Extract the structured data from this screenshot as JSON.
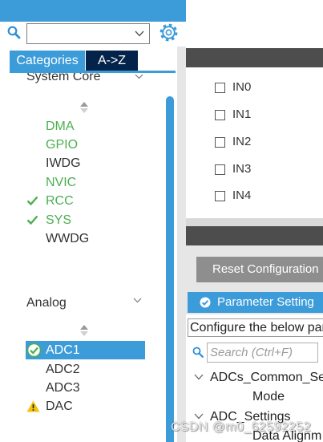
{
  "colors": {
    "accent_blue": "#3c9bd9",
    "navy": "#03234b",
    "enabled_green": "#4caf50",
    "default_text": "#333333",
    "warning_yellow": "#f4c20d",
    "toolbar_dark": "#4d4d4d",
    "button_gray": "#8e8e8e"
  },
  "search": {
    "value": "",
    "icon": "search-icon",
    "dropdown_icon": "chevron-down-icon"
  },
  "settings_icon": "gear-icon",
  "tabs": [
    {
      "label": "Categories",
      "active": true
    },
    {
      "label": "A->Z",
      "active": false
    }
  ],
  "categories": [
    {
      "name": "System Core",
      "expanded": true,
      "sort_icon": "sort-icon",
      "items": [
        {
          "label": "DMA",
          "color": "#4caf50",
          "icon": null
        },
        {
          "label": "GPIO",
          "color": "#4caf50",
          "icon": null
        },
        {
          "label": "IWDG",
          "color": "#333333",
          "icon": null
        },
        {
          "label": "NVIC",
          "color": "#4caf50",
          "icon": null
        },
        {
          "label": "RCC",
          "color": "#4caf50",
          "icon": "check-icon"
        },
        {
          "label": "SYS",
          "color": "#4caf50",
          "icon": "check-icon"
        },
        {
          "label": "WWDG",
          "color": "#333333",
          "icon": null
        }
      ]
    },
    {
      "name": "Analog",
      "expanded": true,
      "sort_icon": "sort-icon",
      "items": [
        {
          "label": "ADC1",
          "color": "#ffffff",
          "icon": "check-circle-icon",
          "selected": true
        },
        {
          "label": "ADC2",
          "color": "#333333",
          "icon": null
        },
        {
          "label": "ADC3",
          "color": "#333333",
          "icon": null
        },
        {
          "label": "DAC",
          "color": "#333333",
          "icon": "warning-icon"
        }
      ]
    }
  ],
  "mode_panel": {
    "channels": [
      {
        "label": "IN0",
        "checked": false
      },
      {
        "label": "IN1",
        "checked": false
      },
      {
        "label": "IN2",
        "checked": false
      },
      {
        "label": "IN3",
        "checked": false
      },
      {
        "label": "IN4",
        "checked": false
      }
    ]
  },
  "configuration_panel": {
    "reset_button": "Reset Configuration",
    "active_tab": {
      "label": "Parameter Setting",
      "icon": "check-circle-icon"
    },
    "hint": "Configure the below par",
    "search_placeholder": "Search (Ctrl+F)",
    "tree": [
      {
        "label": "ADCs_Common_Se",
        "expanded": true,
        "children": [
          "Mode"
        ]
      },
      {
        "label": "ADC_Settings",
        "expanded": true,
        "children": [
          "Data Alignm"
        ]
      }
    ]
  },
  "watermark": "CSDN @m0_62592252"
}
